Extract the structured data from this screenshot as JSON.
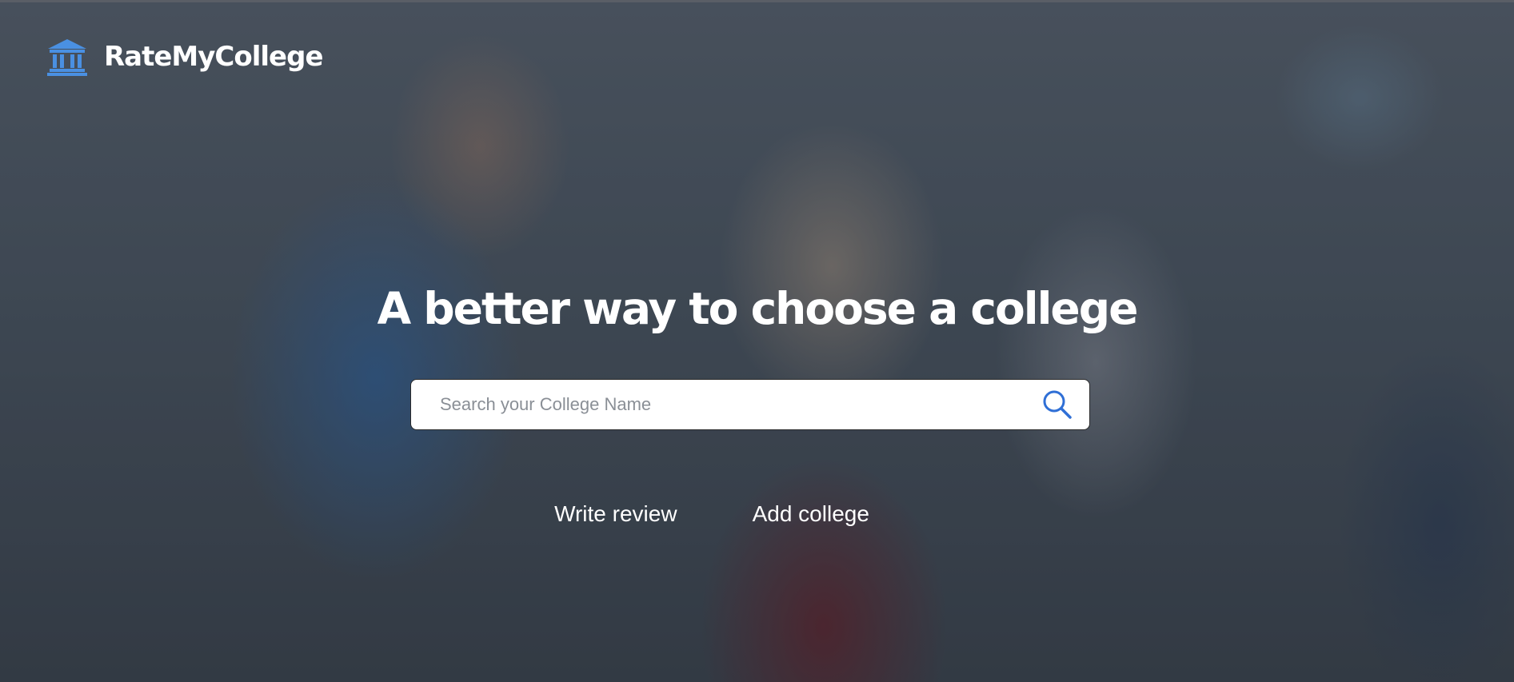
{
  "brand": {
    "name": "RateMyCollege",
    "icon": "institution-icon",
    "icon_color": "#4a90e2"
  },
  "hero": {
    "headline": "A better way to choose a college"
  },
  "search": {
    "placeholder": "Search your College Name",
    "value": "",
    "icon": "search-icon",
    "icon_color": "#2f6fd6"
  },
  "actions": {
    "write_review": "Write review",
    "add_college": "Add college"
  }
}
